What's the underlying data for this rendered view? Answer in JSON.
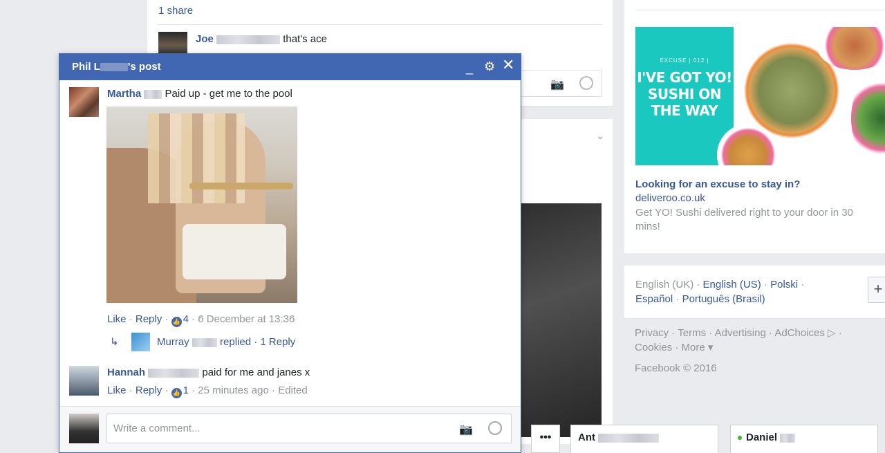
{
  "feed": {
    "share_count": "1 share",
    "top_comment": {
      "author": "Joe",
      "text": "that's ace"
    }
  },
  "popup": {
    "title_prefix": "Phil L",
    "title_suffix": "'s post",
    "comments": [
      {
        "author": "Martha",
        "text": "Paid up - get me to the pool",
        "actions": {
          "like": "Like",
          "reply": "Reply",
          "likes": "4",
          "time": "6 December at 13:36"
        },
        "reply": {
          "author": "Murray",
          "text": "replied",
          "count_label": "1 Reply"
        }
      },
      {
        "author": "Hannah",
        "text": "paid for me and janes x",
        "actions": {
          "like": "Like",
          "reply": "Reply",
          "likes": "1",
          "time": "25 minutes ago",
          "edited": "Edited"
        }
      }
    ],
    "write_placeholder": "Write a comment..."
  },
  "ad": {
    "image_tag": "EXCUSE | 012 |",
    "image_headline": "I'VE GOT YO! SUSHI ON THE WAY",
    "title": "Looking for an excuse to stay in?",
    "domain": "deliveroo.co.uk",
    "description": "Get YO! Sushi delivered right to your door in 30 mins!"
  },
  "languages": {
    "current": "English (UK)",
    "options": [
      "English (US)",
      "Polski",
      "Español",
      "Português (Brasil)"
    ]
  },
  "footer": {
    "links": [
      "Privacy",
      "Terms",
      "Advertising",
      "AdChoices",
      "Cookies",
      "More"
    ],
    "copyright": "Facebook © 2016"
  },
  "chat": {
    "more_label": "•••",
    "tabs": [
      "Ant",
      "Daniel"
    ]
  },
  "colors": {
    "brand_blue": "#4267b2",
    "link": "#365899",
    "muted": "#90949c",
    "online": "#42b72a"
  }
}
